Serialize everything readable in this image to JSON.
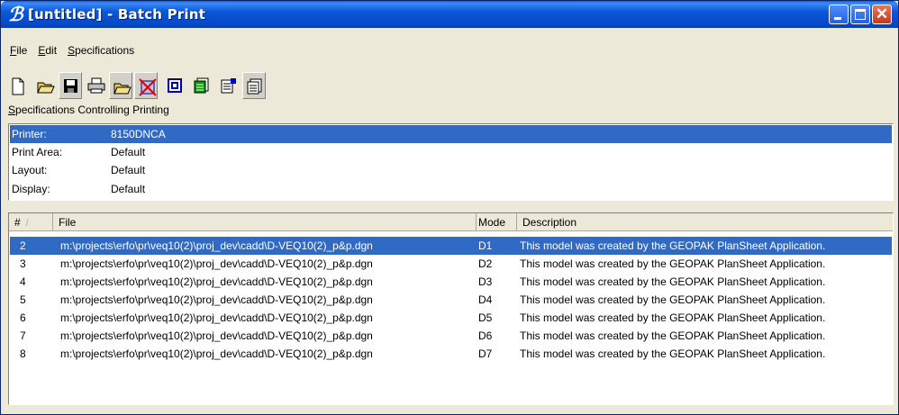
{
  "window": {
    "title": "[untitled] - Batch Print",
    "close_glyph": "✕"
  },
  "menu": [
    "File",
    "Edit",
    "Specifications"
  ],
  "toolbar": {
    "icons": [
      "new-document-icon",
      "open-folder-icon",
      "save-icon",
      "print-icon",
      "open-specs-icon",
      "no-printer-icon",
      "window-icon",
      "sheet-icon",
      "sheet-properties-icon",
      "sheet-list-icon"
    ]
  },
  "specs_section": {
    "label": "Specifications Controlling Printing",
    "rows": [
      {
        "key": "Printer:",
        "value": "8150DNCA",
        "selected": true
      },
      {
        "key": "Print Area:",
        "value": "Default",
        "selected": false
      },
      {
        "key": "Layout:",
        "value": "Default",
        "selected": false
      },
      {
        "key": "Display:",
        "value": "Default",
        "selected": false
      }
    ]
  },
  "file_list": {
    "columns": {
      "num": "#",
      "file": "File",
      "mode": "Mode",
      "description": "Description"
    },
    "sort_indicator": "/",
    "rows": [
      {
        "num": "2",
        "file": "m:\\projects\\erfo\\pr\\veq10(2)\\proj_dev\\cadd\\D-VEQ10(2)_p&p.dgn",
        "mode": "D1",
        "description": "This model was created by the GEOPAK PlanSheet Application.",
        "selected": true
      },
      {
        "num": "3",
        "file": "m:\\projects\\erfo\\pr\\veq10(2)\\proj_dev\\cadd\\D-VEQ10(2)_p&p.dgn",
        "mode": "D2",
        "description": "This model was created by the GEOPAK PlanSheet Application.",
        "selected": false
      },
      {
        "num": "4",
        "file": "m:\\projects\\erfo\\pr\\veq10(2)\\proj_dev\\cadd\\D-VEQ10(2)_p&p.dgn",
        "mode": "D3",
        "description": "This model was created by the GEOPAK PlanSheet Application.",
        "selected": false
      },
      {
        "num": "5",
        "file": "m:\\projects\\erfo\\pr\\veq10(2)\\proj_dev\\cadd\\D-VEQ10(2)_p&p.dgn",
        "mode": "D4",
        "description": "This model was created by the GEOPAK PlanSheet Application.",
        "selected": false
      },
      {
        "num": "6",
        "file": "m:\\projects\\erfo\\pr\\veq10(2)\\proj_dev\\cadd\\D-VEQ10(2)_p&p.dgn",
        "mode": "D5",
        "description": "This model was created by the GEOPAK PlanSheet Application.",
        "selected": false
      },
      {
        "num": "7",
        "file": "m:\\projects\\erfo\\pr\\veq10(2)\\proj_dev\\cadd\\D-VEQ10(2)_p&p.dgn",
        "mode": "D6",
        "description": "This model was created by the GEOPAK PlanSheet Application.",
        "selected": false
      },
      {
        "num": "8",
        "file": "m:\\projects\\erfo\\pr\\veq10(2)\\proj_dev\\cadd\\D-VEQ10(2)_p&p.dgn",
        "mode": "D7",
        "description": "This model was created by the GEOPAK PlanSheet Application.",
        "selected": false
      }
    ]
  },
  "colors": {
    "selection": "#316ac5",
    "titlebar": "#0548c8"
  }
}
